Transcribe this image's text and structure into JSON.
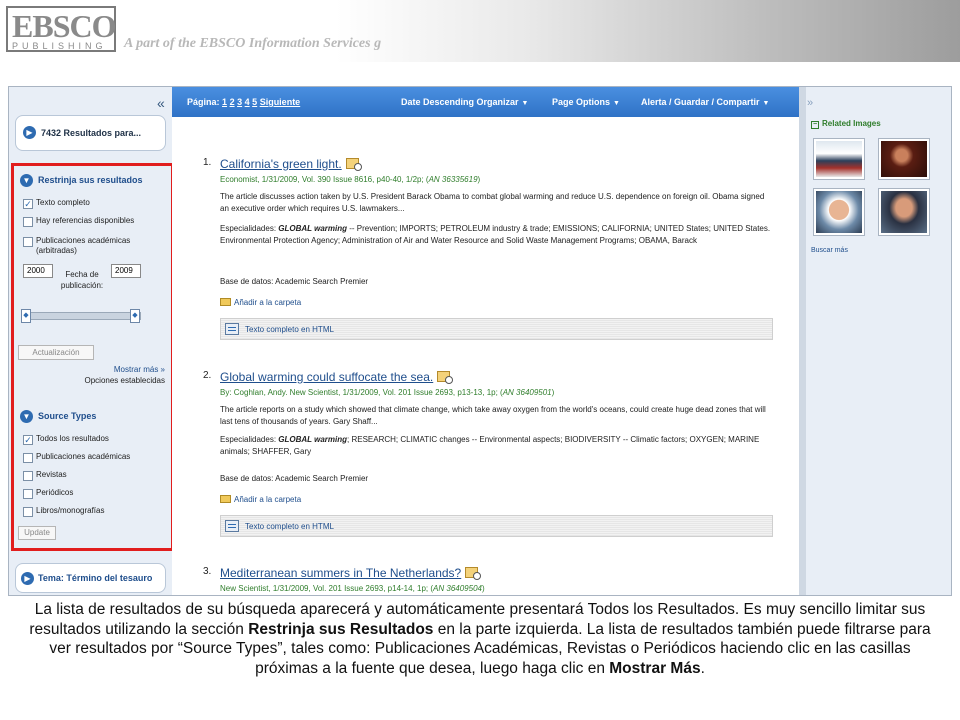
{
  "banner": {
    "logo_main": "EBSCO",
    "logo_sub": "PUBLISHING",
    "tagline": "A part of the EBSCO Information Services g"
  },
  "sidebar": {
    "collapse": "«",
    "results_count": "7432 Resultados para...",
    "refine_heading": "Restrinja sus resultados",
    "refine_options": [
      {
        "label": "Texto completo",
        "checked": true
      },
      {
        "label": "Hay referencias disponibles",
        "checked": false
      },
      {
        "label": "Publicaciones académicas (arbitradas)",
        "checked": false
      }
    ],
    "year_from": "2000",
    "year_to": "2009",
    "date_label": "Fecha de publicación:",
    "update_button": "Actualización",
    "show_more": "Mostrar más »",
    "set_options": "Opciones establecidas",
    "source_heading": "Source Types",
    "source_options": [
      {
        "label": "Todos los resultados",
        "checked": true
      },
      {
        "label": "Publicaciones académicas",
        "checked": false
      },
      {
        "label": "Revistas",
        "checked": false
      },
      {
        "label": "Periódicos",
        "checked": false
      },
      {
        "label": "Libros/monografías",
        "checked": false
      }
    ],
    "source_update": "Update",
    "tema_heading": "Tema: Término del tesauro"
  },
  "toolbar": {
    "page_label": "Página:",
    "pages": [
      "1",
      "2",
      "3",
      "4",
      "5"
    ],
    "next": "Siguiente",
    "sort": "Date Descending Organizar",
    "page_options": "Page Options",
    "alert": "Alerta / Guardar / Compartir",
    "expand": "»"
  },
  "results": [
    {
      "num": "1.",
      "title": "California's green light.",
      "source_text": "Economist, 1/31/2009, Vol. 390 Issue 8616, p40-40, 1/2p; (",
      "an": "AN 36335619",
      "abstract": "The article discusses action taken by U.S. President Barack Obama to combat global warming and reduce U.S. dependence on foreign oil. Obama signed an executive order which requires U.S. lawmakers...",
      "subjects_label": "Especialidades:",
      "subjects_bold": "GLOBAL warming",
      "subjects_rest": " -- Prevention; IMPORTS; PETROLEUM industry & trade; EMISSIONS; CALIFORNIA; UNITED States; UNITED States. Environmental Protection Agency; Administration of Air and Water Resource and Solid Waste Management Programs; OBAMA, Barack",
      "database": "Base de datos: Academic Search Premier",
      "folder": "Añadir a la carpeta",
      "fulltext": "Texto completo en HTML"
    },
    {
      "num": "2.",
      "title": "Global warming could suffocate the sea.",
      "source_text": "By: Coghlan, Andy. New Scientist, 1/31/2009, Vol. 201 Issue 2693, p13-13, 1p; (",
      "an": "AN 36409501",
      "abstract": "The article reports on a study which showed that climate change, which take away oxygen from the world's oceans, could create huge dead zones that will last tens of thousands of years. Gary Shaff...",
      "subjects_label": "Especialidades:",
      "subjects_bold": "GLOBAL warming",
      "subjects_rest": "; RESEARCH; CLIMATIC changes -- Environmental aspects; BIODIVERSITY -- Climatic factors; OXYGEN; MARINE animals; SHAFFER, Gary",
      "database": "Base de datos: Academic Search Premier",
      "folder": "Añadir a la carpeta",
      "fulltext": "Texto completo en HTML"
    },
    {
      "num": "3.",
      "title": "Mediterranean summers in The Netherlands?",
      "source_text": "New Scientist, 1/31/2009, Vol. 201 Issue 2693, p14-14, 1p; (",
      "an": "AN 36409504"
    }
  ],
  "rail": {
    "heading": "Related Images",
    "more": "Buscar más"
  },
  "caption": {
    "p1": "La lista de resultados de su búsqueda aparecerá y automáticamente presentará Todos los Resultados. Es muy sencillo limitar sus resultados utilizando la sección ",
    "b1": "Restrinja sus Resultados",
    "p2": " en la parte izquierda. La lista de resultados también puede filtrarse para ver resultados por “Source Types”, tales como: Publicaciones Académicas, Revistas o Periódicos haciendo clic en las casillas próximas a la fuente que desea, luego haga clic en ",
    "b2": "Mostrar Más",
    "p3": "."
  },
  "colors": {
    "toolbar_blue": "#2f72c6",
    "link_blue": "#1f4e8c",
    "source_green": "#2f7d2b",
    "highlight_red": "#e11d1d",
    "sidebar_bg": "#e8eef6"
  }
}
